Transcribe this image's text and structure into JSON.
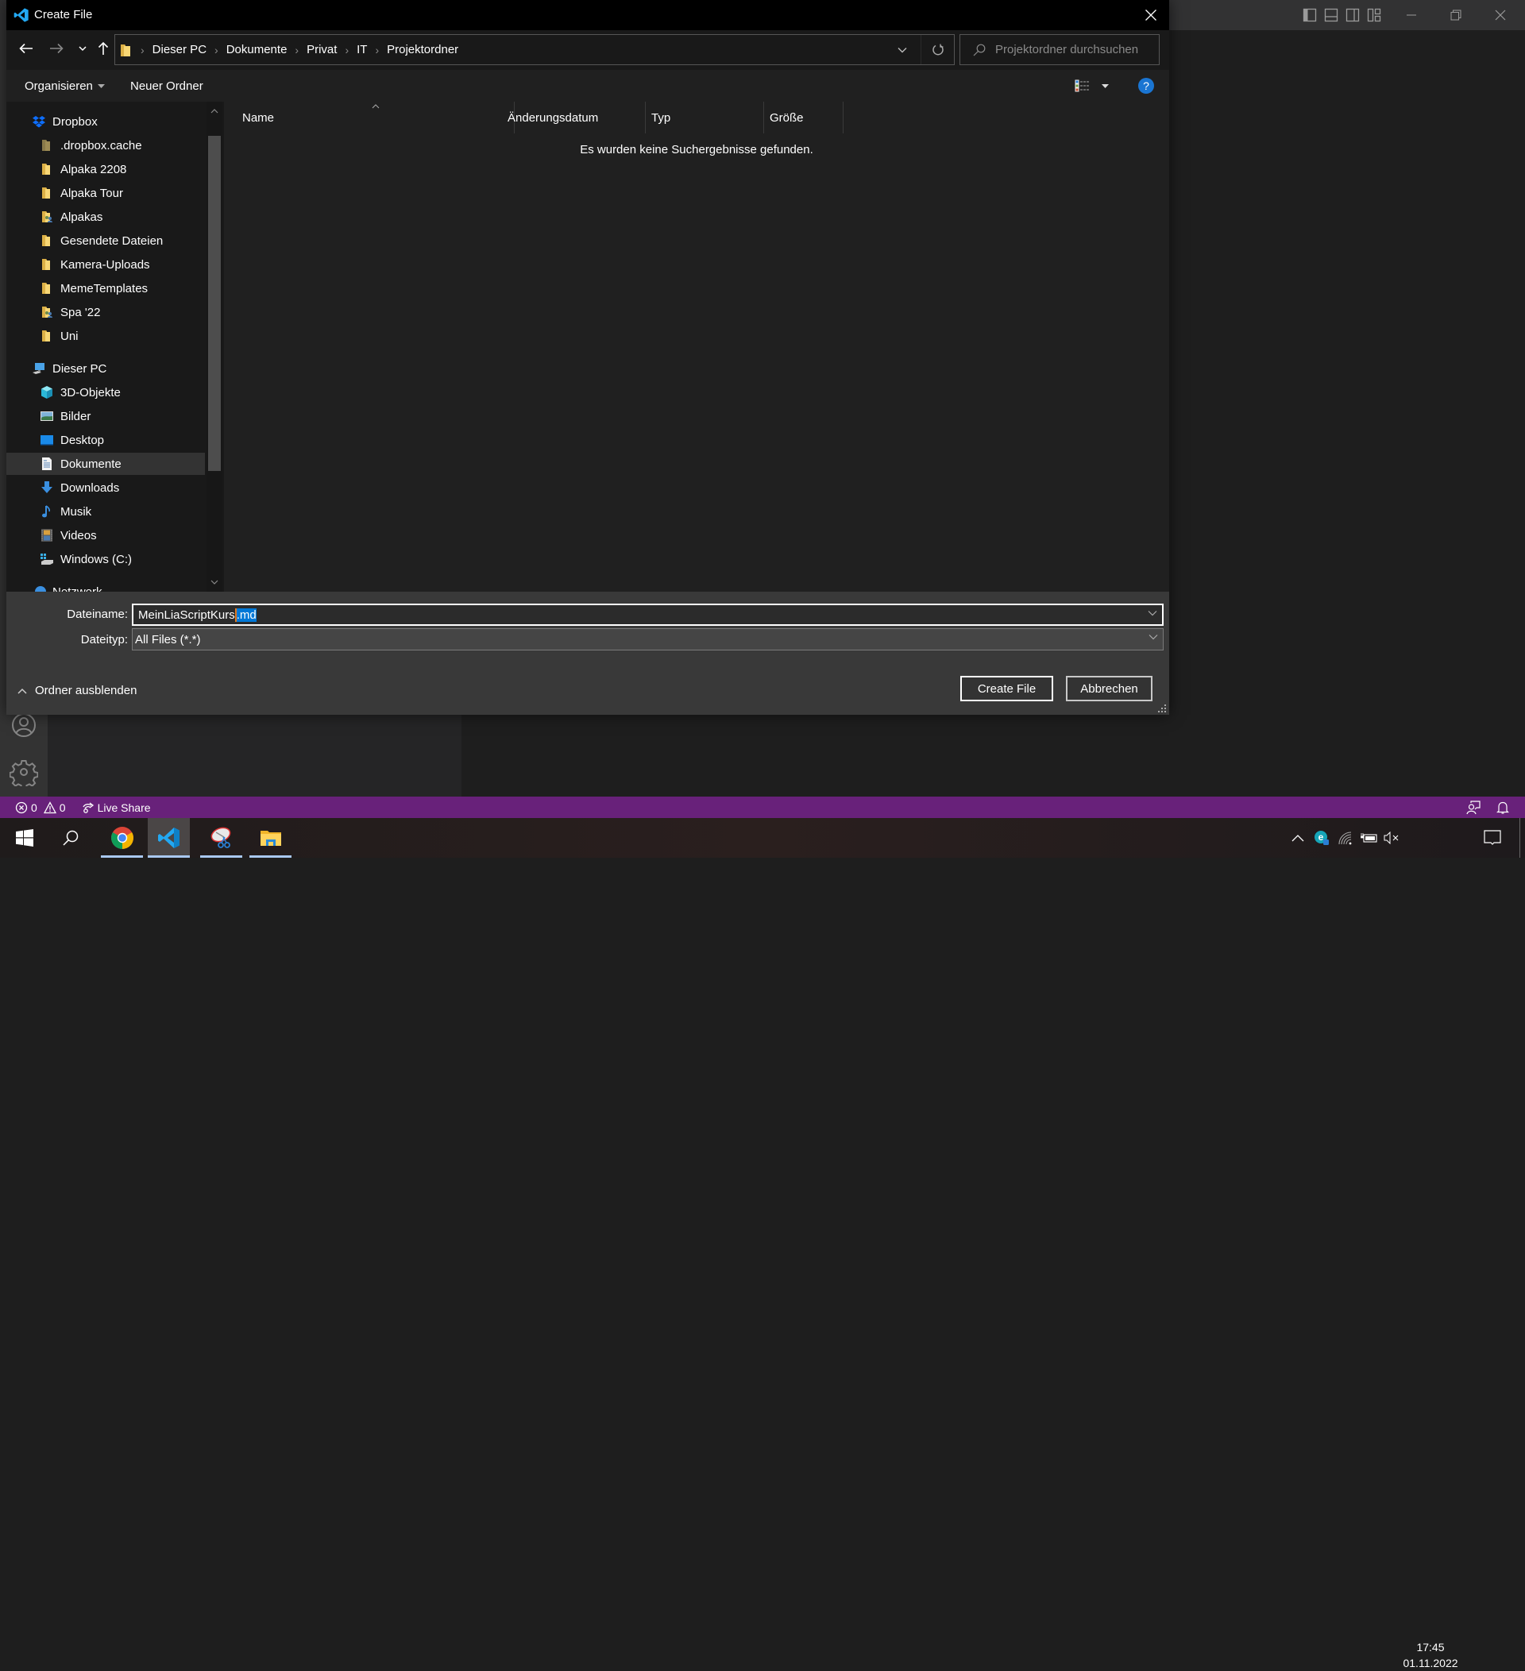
{
  "vscode": {
    "window_controls": [
      "minimize",
      "restore",
      "close"
    ],
    "layout_controls": [
      "toggle-primary-sidebar",
      "toggle-panel",
      "toggle-secondary-sidebar",
      "customize-layout"
    ],
    "activity_bottom": [
      "accounts",
      "manage"
    ],
    "statusbar": {
      "errors": "0",
      "warnings": "0",
      "live_share": "Live Share",
      "color": "#68217a"
    }
  },
  "dialog": {
    "title": "Create File",
    "breadcrumb": [
      "Dieser PC",
      "Dokumente",
      "Privat",
      "IT",
      "Projektordner"
    ],
    "search_placeholder": "Projektordner durchsuchen",
    "toolbar": {
      "organize": "Organisieren",
      "new_folder": "Neuer Ordner"
    },
    "nav_pane": {
      "groups": [
        {
          "label": "Dropbox",
          "icon": "dropbox-icon",
          "items": [
            {
              "label": ".dropbox.cache",
              "icon": "folder-hidden-icon"
            },
            {
              "label": "Alpaka 2208",
              "icon": "folder-icon"
            },
            {
              "label": "Alpaka Tour",
              "icon": "folder-icon"
            },
            {
              "label": "Alpakas",
              "icon": "folder-shared-icon"
            },
            {
              "label": "Gesendete Dateien",
              "icon": "folder-icon"
            },
            {
              "label": "Kamera-Uploads",
              "icon": "folder-icon"
            },
            {
              "label": "MemeTemplates",
              "icon": "folder-icon"
            },
            {
              "label": "Spa '22",
              "icon": "folder-shared-icon"
            },
            {
              "label": "Uni",
              "icon": "folder-icon"
            }
          ]
        },
        {
          "label": "Dieser PC",
          "icon": "computer-icon",
          "items": [
            {
              "label": "3D-Objekte",
              "icon": "cube-icon"
            },
            {
              "label": "Bilder",
              "icon": "pictures-icon"
            },
            {
              "label": "Desktop",
              "icon": "desktop-icon"
            },
            {
              "label": "Dokumente",
              "icon": "documents-icon",
              "selected": true
            },
            {
              "label": "Downloads",
              "icon": "download-icon"
            },
            {
              "label": "Musik",
              "icon": "music-icon"
            },
            {
              "label": "Videos",
              "icon": "videos-icon"
            },
            {
              "label": "Windows (C:)",
              "icon": "drive-icon"
            }
          ]
        },
        {
          "label": "Netzwerk",
          "icon": "network-icon",
          "items": []
        }
      ]
    },
    "columns": [
      "Name",
      "Änderungsdatum",
      "Typ",
      "Größe"
    ],
    "empty_message": "Es wurden keine Suchergebnisse gefunden.",
    "filename_label": "Dateiname:",
    "filename_value_base": "MeinLiaScriptKurs",
    "filename_value_selected": ".md",
    "filetype_label": "Dateityp:",
    "filetype_value": "All Files (*.*)",
    "create_button": "Create File",
    "cancel_button": "Abbrechen",
    "toggle_folders": "Ordner ausblenden"
  },
  "taskbar": {
    "apps": [
      {
        "name": "chrome",
        "active": false
      },
      {
        "name": "vscode",
        "active": true
      },
      {
        "name": "snipping-tool",
        "active": false
      },
      {
        "name": "file-explorer",
        "active": false
      }
    ],
    "time": "17:45",
    "date": "01.11.2022"
  }
}
